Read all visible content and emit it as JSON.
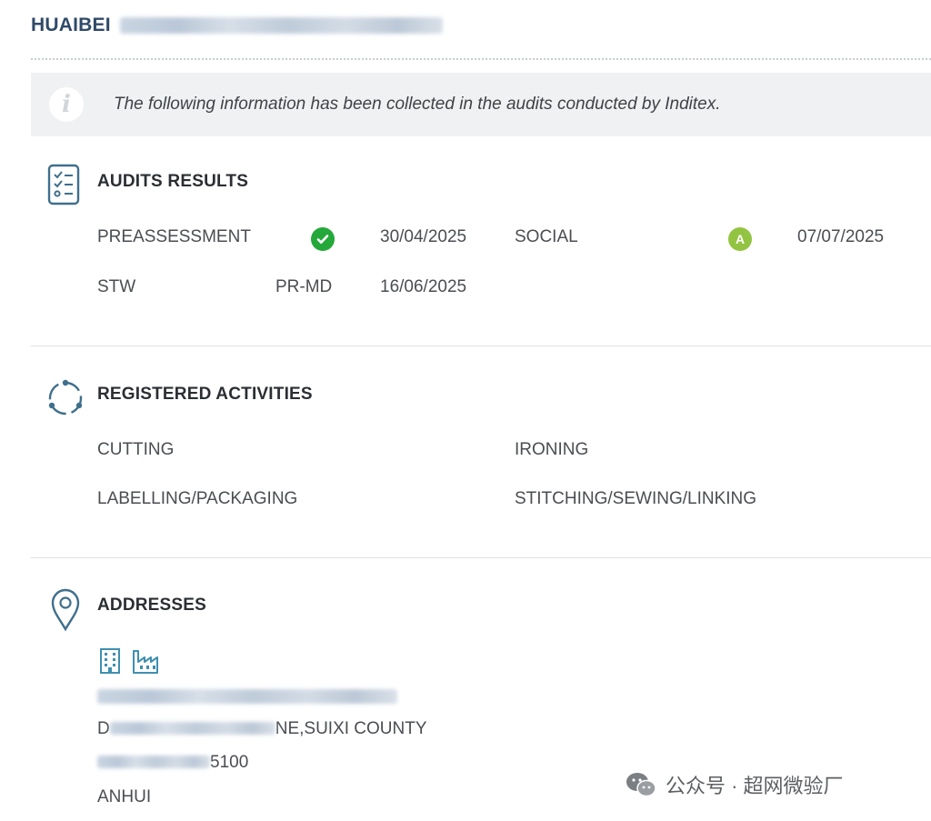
{
  "header": {
    "company_prefix": "HUAIBEI"
  },
  "info": {
    "text": "The following information has been collected in the audits conducted by Inditex."
  },
  "audits": {
    "title": "AUDITS RESULTS",
    "row1": {
      "type1": "PREASSESSMENT",
      "date1": "30/04/2025",
      "type2": "SOCIAL",
      "grade2": "A",
      "date2": "07/07/2025"
    },
    "row2": {
      "type": "STW",
      "result": "PR-MD",
      "date": "16/06/2025"
    }
  },
  "activities": {
    "title": "REGISTERED ACTIVITIES",
    "items": [
      "CUTTING",
      "IRONING",
      "LABELLING/PACKAGING",
      "STITCHING/SEWING/LINKING"
    ]
  },
  "addresses": {
    "title": "ADDRESSES",
    "line2_start": "D",
    "line2_end": "NE,SUIXI COUNTY",
    "line3_end": "5100",
    "line4": "ANHUI"
  },
  "watermark": {
    "text": "公众号 · 超网微验厂"
  },
  "colors": {
    "brand_blue": "#2f4a68",
    "ok_green": "#24a83a",
    "grade_green": "#93c441",
    "icon_teal": "#3f6f8c"
  }
}
